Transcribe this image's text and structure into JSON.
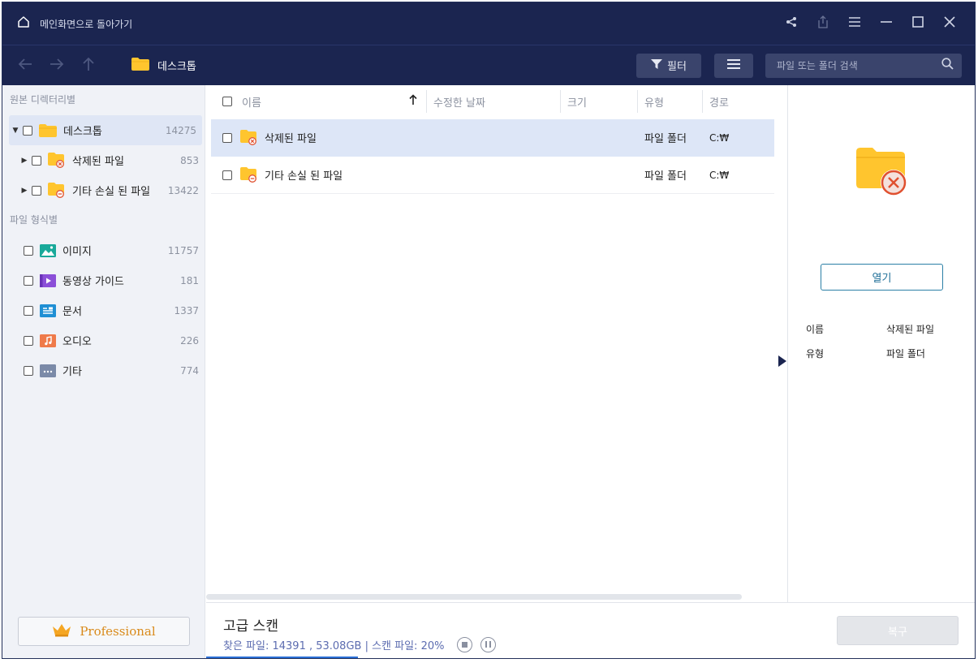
{
  "titlebar": {
    "home_label": "메인화면으로 돌아가기"
  },
  "toolbar": {
    "breadcrumb": "데스크톱",
    "filter_label": "필터",
    "search_placeholder": "파일 또는 폴더 검색"
  },
  "sidebar": {
    "dir_section": "원본 디렉터리별",
    "dir_items": [
      {
        "label": "데스크톱",
        "count": "14275"
      },
      {
        "label": "삭제된 파일",
        "count": "853"
      },
      {
        "label": "기타 손실 된 파일",
        "count": "13422"
      }
    ],
    "type_section": "파일 형식별",
    "type_items": [
      {
        "label": "이미지",
        "count": "11757",
        "icon": "image-icon"
      },
      {
        "label": "동영상 가이드",
        "count": "181",
        "icon": "video-icon"
      },
      {
        "label": "문서",
        "count": "1337",
        "icon": "document-icon"
      },
      {
        "label": "오디오",
        "count": "226",
        "icon": "audio-icon"
      },
      {
        "label": "기타",
        "count": "774",
        "icon": "other-icon"
      }
    ],
    "professional_label": "Professional"
  },
  "list": {
    "columns": {
      "name": "이름",
      "modified": "수정한 날짜",
      "size": "크기",
      "type": "유형",
      "path": "경로"
    },
    "rows": [
      {
        "name": "삭제된 파일",
        "modified": "",
        "size": "",
        "type": "파일 폴더",
        "path": "C:₩"
      },
      {
        "name": "기타 손실 된 파일",
        "modified": "",
        "size": "",
        "type": "파일 폴더",
        "path": "C:₩"
      }
    ]
  },
  "details": {
    "open_label": "열기",
    "name_key": "이름",
    "name_value": "삭제된 파일",
    "type_key": "유형",
    "type_value": "파일 폴더"
  },
  "bottom": {
    "scan_title": "고급 스캔",
    "scan_status": "찾은 파일: 14391 , 53.08GB | 스캔 파일: 20%",
    "scan_progress_percent": 20,
    "recover_label": "복구"
  },
  "colors": {
    "titlebar_bg": "#1b2550",
    "accent": "#2a6fd6",
    "folder": "#ffc52e",
    "deleted_badge": "#e0502f"
  }
}
